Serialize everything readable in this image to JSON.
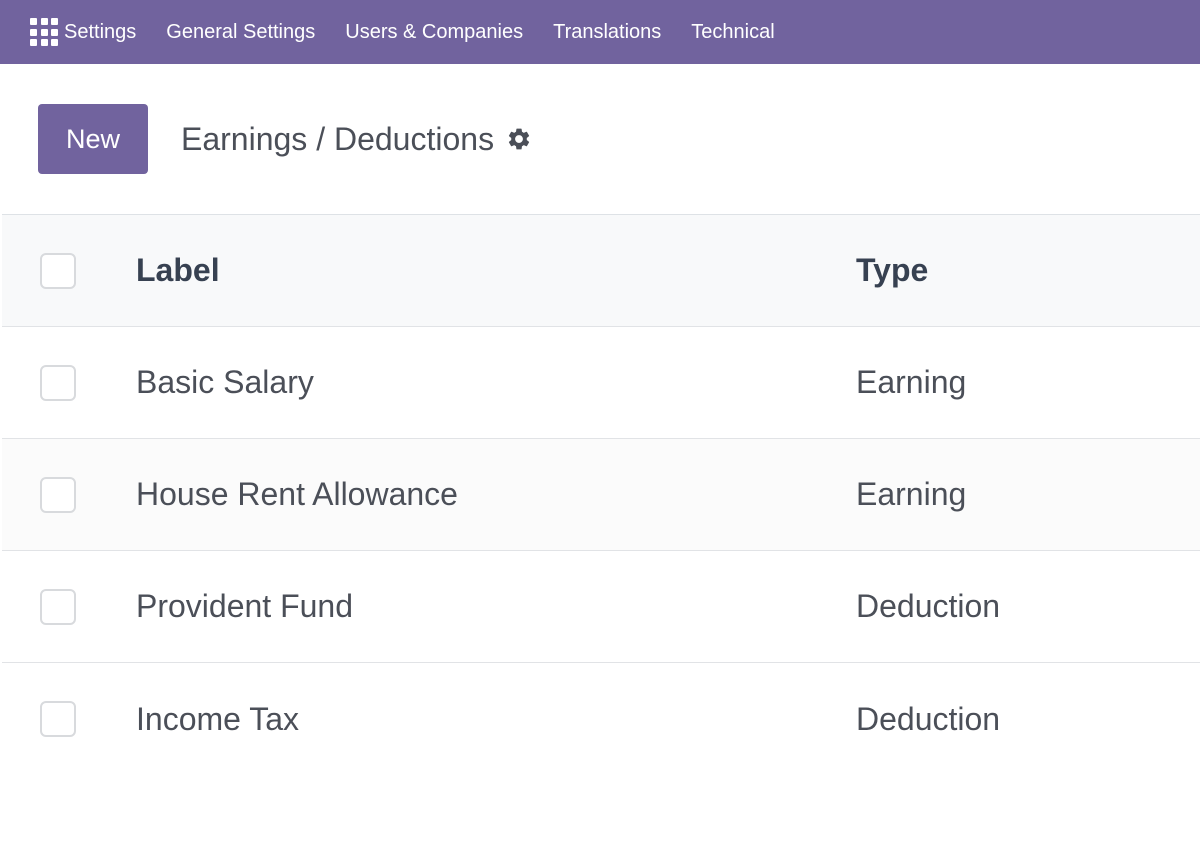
{
  "navbar": {
    "apps_icon": "apps-grid-icon",
    "brand": "Settings",
    "menu": [
      {
        "label": "General Settings"
      },
      {
        "label": "Users & Companies"
      },
      {
        "label": "Translations"
      },
      {
        "label": "Technical"
      }
    ],
    "color": "#71639e"
  },
  "control_panel": {
    "new_button": "New",
    "title": "Earnings / Deductions",
    "gear_icon": "gear-icon"
  },
  "table": {
    "columns": {
      "label": "Label",
      "type": "Type"
    },
    "rows": [
      {
        "label": "Basic Salary",
        "type": "Earning"
      },
      {
        "label": "House Rent Allowance",
        "type": "Earning"
      },
      {
        "label": "Provident Fund",
        "type": "Deduction"
      },
      {
        "label": "Income Tax",
        "type": "Deduction"
      }
    ]
  }
}
